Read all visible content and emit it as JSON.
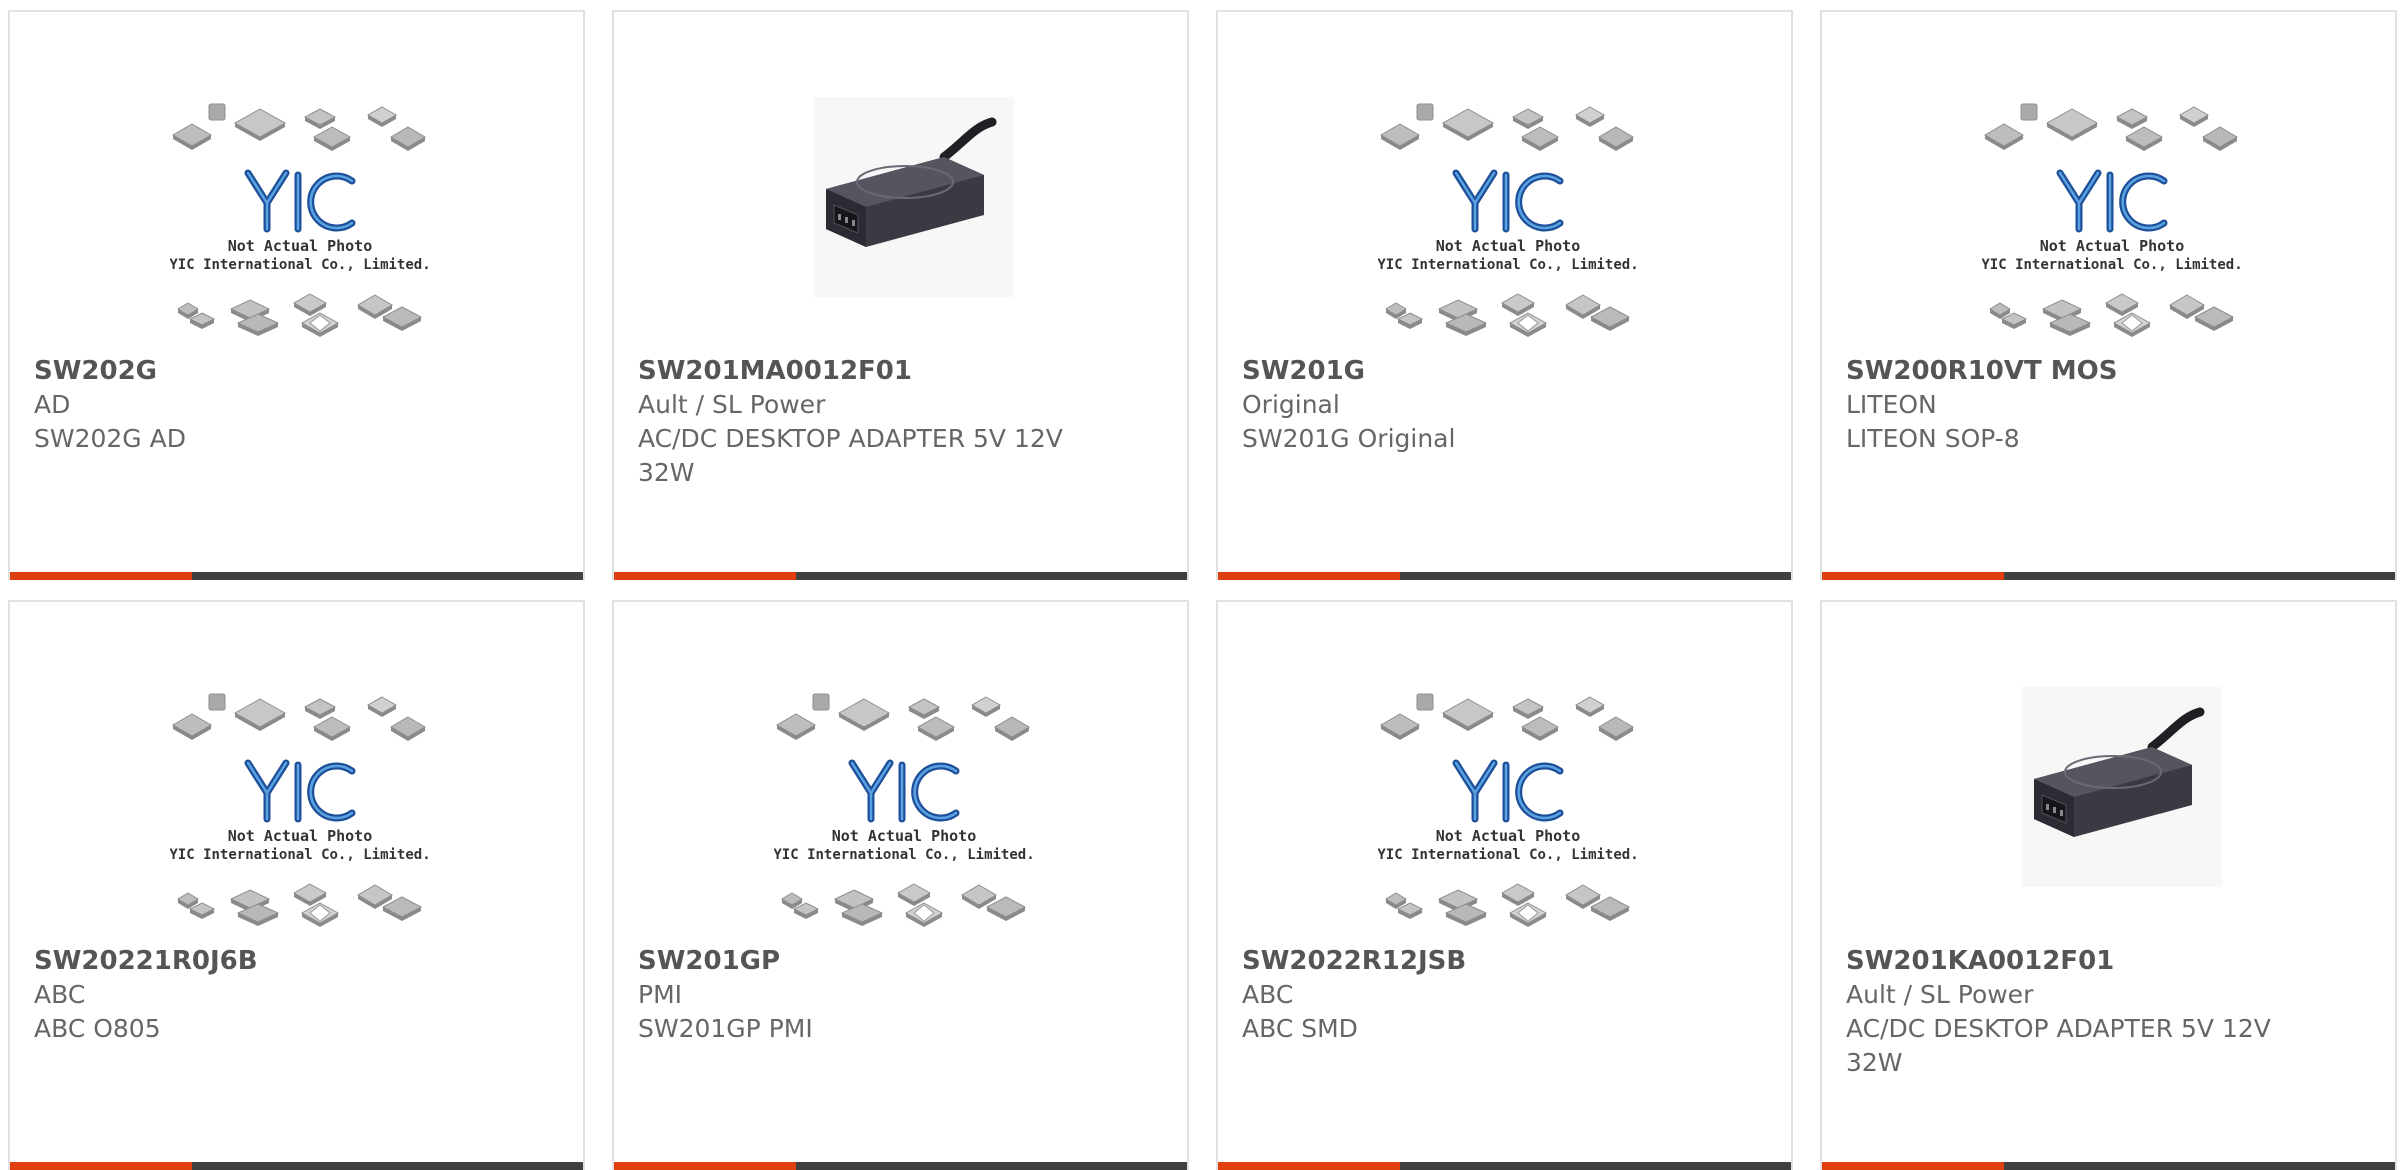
{
  "theme": {
    "accent_color": "#e0400f",
    "bar_color": "#404040"
  },
  "placeholder_image": {
    "caption_line1": "Not Actual Photo",
    "caption_line2": "YIC International Co., Limited.",
    "logo_text": "YIC"
  },
  "products": [
    {
      "part": "SW202G",
      "manufacturer": "AD",
      "description": "SW202G AD",
      "image": "placeholder"
    },
    {
      "part": "SW201MA0012F01",
      "manufacturer": "Ault / SL Power",
      "description": "AC/DC DESKTOP ADAPTER 5V 12V 32W",
      "image": "power-adapter"
    },
    {
      "part": "SW201G",
      "manufacturer": "Original",
      "description": "SW201G Original",
      "image": "placeholder"
    },
    {
      "part": "SW200R10VT MOS",
      "manufacturer": "LITEON",
      "description": "LITEON SOP-8",
      "image": "placeholder"
    },
    {
      "part": "SW20221R0J6B",
      "manufacturer": "ABC",
      "description": "ABC O805",
      "image": "placeholder"
    },
    {
      "part": "SW201GP",
      "manufacturer": "PMI",
      "description": "SW201GP PMI",
      "image": "placeholder"
    },
    {
      "part": "SW2022R12JSB",
      "manufacturer": "ABC",
      "description": "ABC SMD",
      "image": "placeholder"
    },
    {
      "part": "SW201KA0012F01",
      "manufacturer": "Ault / SL Power",
      "description": "AC/DC DESKTOP ADAPTER 5V 12V 32W",
      "image": "power-adapter"
    }
  ]
}
